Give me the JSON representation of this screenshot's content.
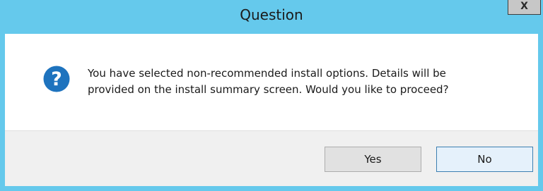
{
  "dialog": {
    "title": "Question",
    "close_label": "X",
    "icon": "question-icon",
    "message_line1": "You have selected non-recommended install options. Details will be",
    "message_line2": "provided on the install summary screen. Would you like to proceed?",
    "buttons": {
      "yes_label": "Yes",
      "no_label": "No"
    }
  },
  "colors": {
    "titlebar": "#65c9ec",
    "icon_blue": "#1e73be",
    "footer": "#f0f0f0"
  }
}
